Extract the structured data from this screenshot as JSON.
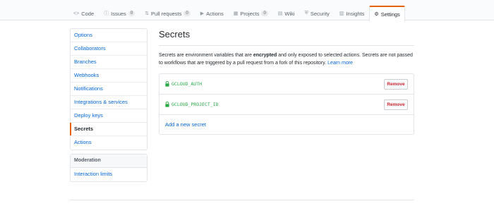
{
  "repo_nav": {
    "tabs": [
      {
        "icon": "code-icon",
        "glyph": "<>",
        "label": "Code"
      },
      {
        "icon": "issue-icon",
        "glyph": "ⓘ",
        "label": "Issues",
        "count": "0"
      },
      {
        "icon": "pull-request-icon",
        "glyph": "⇅",
        "label": "Pull requests",
        "count": "0"
      },
      {
        "icon": "actions-icon",
        "glyph": "▶",
        "label": "Actions"
      },
      {
        "icon": "project-icon",
        "glyph": "▦",
        "label": "Projects",
        "count": "0"
      },
      {
        "icon": "wiki-icon",
        "glyph": "▤",
        "label": "Wiki"
      },
      {
        "icon": "shield-icon",
        "glyph": "⛨",
        "label": "Security"
      },
      {
        "icon": "graph-icon",
        "glyph": "▥",
        "label": "Insights"
      },
      {
        "icon": "gear-icon",
        "glyph": "⚙",
        "label": "Settings",
        "selected": true
      }
    ]
  },
  "sidebar": {
    "items": [
      {
        "label": "Options"
      },
      {
        "label": "Collaborators"
      },
      {
        "label": "Branches"
      },
      {
        "label": "Webhooks"
      },
      {
        "label": "Notifications"
      },
      {
        "label": "Integrations & services"
      },
      {
        "label": "Deploy keys"
      },
      {
        "label": "Secrets",
        "selected": true
      },
      {
        "label": "Actions"
      }
    ],
    "moderation": {
      "heading": "Moderation",
      "items": [
        {
          "label": "Interaction limits"
        }
      ]
    }
  },
  "main": {
    "title": "Secrets",
    "description_before": "Secrets are environment variables that are ",
    "description_bold": "encrypted",
    "description_after": " and only exposed to selected actions. Secrets are not passed to workflows that are triggered by a pull request from a fork of this repository. ",
    "learn_more": "Learn more",
    "secrets": [
      {
        "name": "GCLOUD_AUTH",
        "remove_label": "Remove"
      },
      {
        "name": "GCLOUD_PROJECT_ID",
        "remove_label": "Remove"
      }
    ],
    "add_secret": "Add a new secret"
  },
  "colors": {
    "accent": "#e36209",
    "link": "#0366d6",
    "secret_green": "#28a745",
    "danger": "#cb2431"
  }
}
